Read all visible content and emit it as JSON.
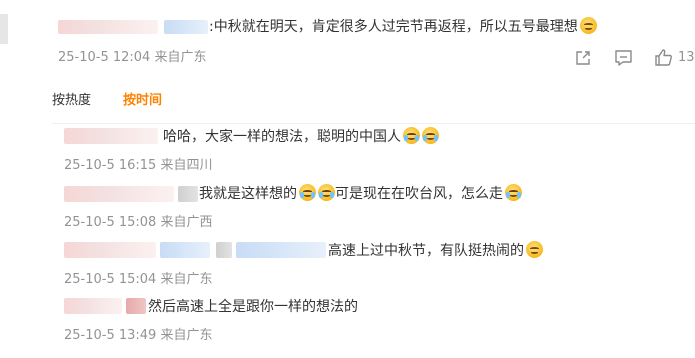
{
  "main_comment": {
    "text": ":中秋就在明天，肯定很多人过完节再返程，所以五号最理想",
    "timestamp": "25-10-5 12:04",
    "location": "来自广东",
    "like_count": "13",
    "icons": [
      "share-icon",
      "comment-icon",
      "like-icon"
    ]
  },
  "sort_tabs": {
    "by_heat": "按热度",
    "by_time": "按时间",
    "active_color": "#ff8200"
  },
  "replies": [
    {
      "text": "哈哈，大家一样的想法，聪明的中国人",
      "timestamp": "25-10-5 16:15",
      "location": "来自四川"
    },
    {
      "text_a": "我就是这样想的",
      "text_b": "可是现在在吹台风，怎么走",
      "timestamp": "25-10-5 15:08",
      "location": "来自广西"
    },
    {
      "text": "高速上过中秋节，有队挺热闹的",
      "timestamp": "25-10-5 15:04",
      "location": "来自广东"
    },
    {
      "text": "然后高速上全是跟你一样的想法的",
      "timestamp": "25-10-5 13:49",
      "location": "来自广东"
    }
  ]
}
